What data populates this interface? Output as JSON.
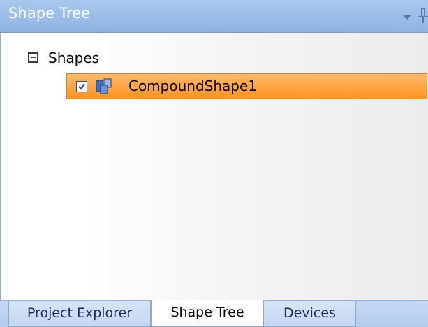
{
  "panel": {
    "title": "Shape Tree"
  },
  "tree": {
    "root": {
      "label": "Shapes",
      "expanded": true
    },
    "nodes": [
      {
        "label": "CompoundShape1",
        "checked": true,
        "selected": true,
        "icon": "compound-shape-icon"
      }
    ]
  },
  "tabs": [
    {
      "label": "Project Explorer",
      "active": false
    },
    {
      "label": "Shape Tree",
      "active": true
    },
    {
      "label": "Devices",
      "active": false
    }
  ],
  "colors": {
    "titlebar": "#9dbfea",
    "selection": "#ffa545",
    "tab_active": "#ffffff",
    "tab_inactive": "#c3d7f1"
  }
}
